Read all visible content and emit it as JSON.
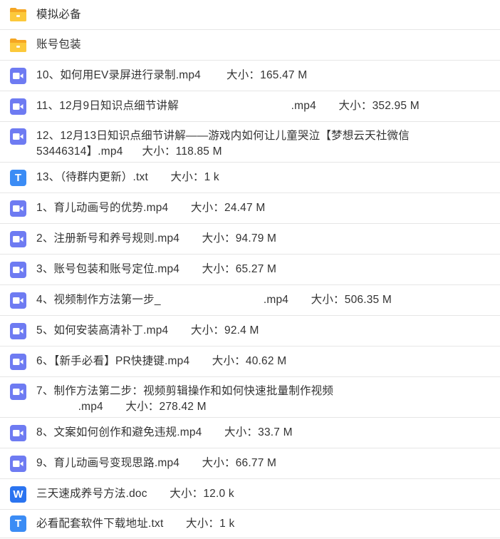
{
  "files": [
    {
      "type": "folder",
      "name": "模拟必备"
    },
    {
      "type": "folder",
      "name": "账号包装"
    },
    {
      "type": "video",
      "name": "10、如何用EV录屏进行录制.mp4        大小：165.47 M"
    },
    {
      "type": "video",
      "name": "11、12月9日知识点细节讲解                                   .mp4       大小：352.95 M"
    },
    {
      "type": "video",
      "name": "12、12月13日知识点细节讲解——游戏内如何让儿童哭泣【梦想云天社微信53446314】.mp4      大小：118.85 M",
      "tall": true
    },
    {
      "type": "txt",
      "name": "13、（待群内更新）.txt       大小：1 k"
    },
    {
      "type": "video",
      "name": "1、育儿动画号的优势.mp4       大小：24.47 M"
    },
    {
      "type": "video",
      "name": "2、注册新号和养号规则.mp4       大小：94.79 M"
    },
    {
      "type": "video",
      "name": "3、账号包装和账号定位.mp4       大小：65.27 M"
    },
    {
      "type": "video",
      "name": "4、视频制作方法第一步_                                .mp4       大小：506.35 M"
    },
    {
      "type": "video",
      "name": "5、如何安装高清补丁.mp4       大小：92.4 M"
    },
    {
      "type": "video",
      "name": "6、【新手必看】PR快捷键.mp4       大小：40.62 M"
    },
    {
      "type": "video",
      "name": "7、制作方法第二步：视频剪辑操作和如何快速批量制作视频\n             .mp4       大小：278.42 M",
      "tall": true
    },
    {
      "type": "video",
      "name": "8、文案如何创作和避免违规.mp4       大小：33.7 M"
    },
    {
      "type": "video",
      "name": "9、育儿动画号变现思路.mp4       大小：66.77 M"
    },
    {
      "type": "doc",
      "name": "三天速成养号方法.doc       大小：12.0 k"
    },
    {
      "type": "txt",
      "name": "必看配套软件下载地址.txt       大小：1 k"
    }
  ],
  "icons": {
    "folder": "folder-icon",
    "video": "video-file-icon",
    "txt": "text-file-icon",
    "doc": "word-file-icon"
  },
  "icon_letters": {
    "txt": "T",
    "doc": "W"
  },
  "colors": {
    "folder": "#f9bf30",
    "video": "#6e7bf2",
    "txt": "#3b8cf5",
    "doc": "#2b74f0",
    "divider": "#e6e6e6",
    "text": "#333333"
  }
}
